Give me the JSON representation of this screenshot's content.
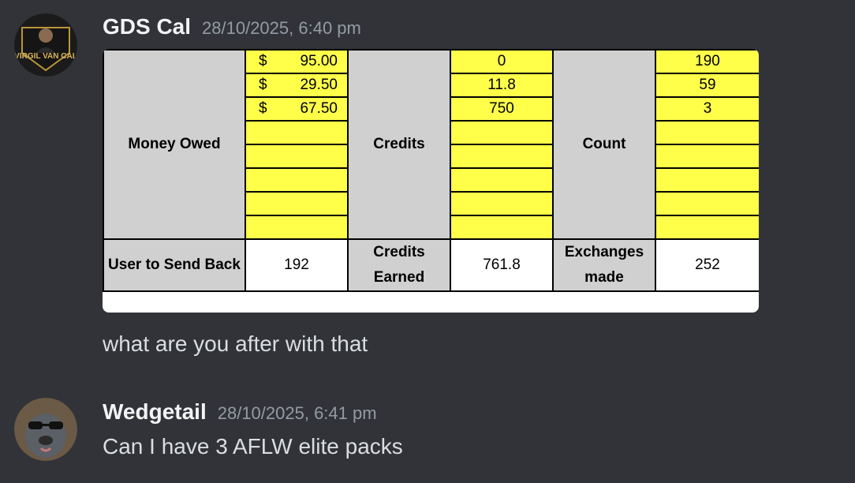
{
  "messages": [
    {
      "author": "GDS Cal",
      "timestamp": "28/10/2025, 6:40 pm",
      "avatar_icon": "virgil-van-cal-avatar-icon",
      "avatar_text": "VIRGIL VAN CAL",
      "text": "what are you after with that"
    },
    {
      "author": "Wedgetail",
      "timestamp": "28/10/2025, 6:41 pm",
      "avatar_icon": "dog-with-sunglasses-avatar-icon",
      "text": "Can I have 3 AFLW elite packs"
    }
  ],
  "sheet": {
    "currency": "$",
    "headers": {
      "money": "Money Owed",
      "credits": "Credits",
      "count": "Count"
    },
    "money_owed": [
      "95.00",
      "29.50",
      "67.50",
      "",
      "",
      "",
      "",
      ""
    ],
    "credits": [
      "0",
      "11.8",
      "750",
      "",
      "",
      "",
      "",
      ""
    ],
    "count": [
      "190",
      "59",
      "3",
      "",
      "",
      "",
      "",
      ""
    ],
    "totals": {
      "user_to_send_back_label": "User to Send Back",
      "user_to_send_back": "192",
      "credits_earned_label": "Credits Earned",
      "credits_earned": "761.8",
      "exchanges_made_label": "Exchanges made",
      "exchanges_made": "252"
    },
    "colors": {
      "highlight": "#ffff4a",
      "label_bg": "#d0d0d0"
    }
  }
}
